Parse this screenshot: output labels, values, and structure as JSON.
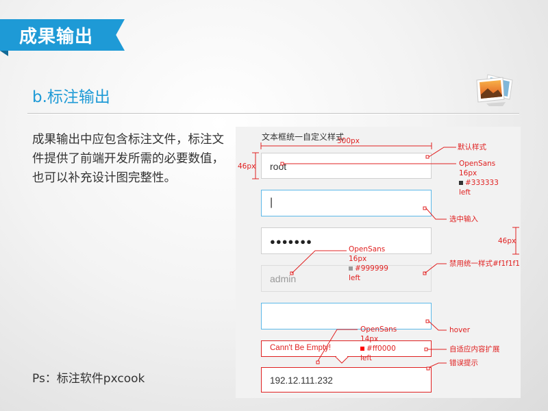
{
  "header": {
    "section_title": "成果输出"
  },
  "subtitle": "b.标注输出",
  "description": "成果输出中应包含标注文件，标注文件提供了前端开发所需的必要数值，也可以补充设计图完整性。",
  "footer_note": "Ps：标注软件pxcook",
  "mockup": {
    "title": "文本框统一自定义样式",
    "fields": {
      "default_value": "root",
      "focus_cursor": "|",
      "password_mask": "●●●●●●●",
      "disabled_value": "admin",
      "hover_value": "",
      "error_message": "Cann't Be Empty!",
      "filled_value": "192.12.111.232"
    },
    "annotations": {
      "width_label": "300px",
      "height_left_label": "46px",
      "height_right_label": "46px",
      "default_style": "默认样式",
      "font_default": {
        "font": "OpenSans",
        "size": "16px",
        "color": "#333333",
        "align": "left"
      },
      "focus_input": "选中输入",
      "font_disabled": {
        "font": "OpenSans",
        "size": "16px",
        "color": "#999999",
        "align": "left"
      },
      "disabled_style": "禁用统一样式#f1f1f1",
      "hover": "hover",
      "font_error": {
        "font": "OpenSans",
        "size": "14px",
        "color": "#ff0000",
        "align": "left"
      },
      "auto_expand": "自适应内容扩展",
      "error_tip": "错误提示"
    }
  },
  "colors": {
    "accent": "#1e9ad6",
    "annotation": "#e02020",
    "focus_border": "#5bb8e8",
    "disabled_bg": "#f1f1f1",
    "error": "#ff0000"
  },
  "icons": {
    "top_right": "photo-stack-icon"
  }
}
